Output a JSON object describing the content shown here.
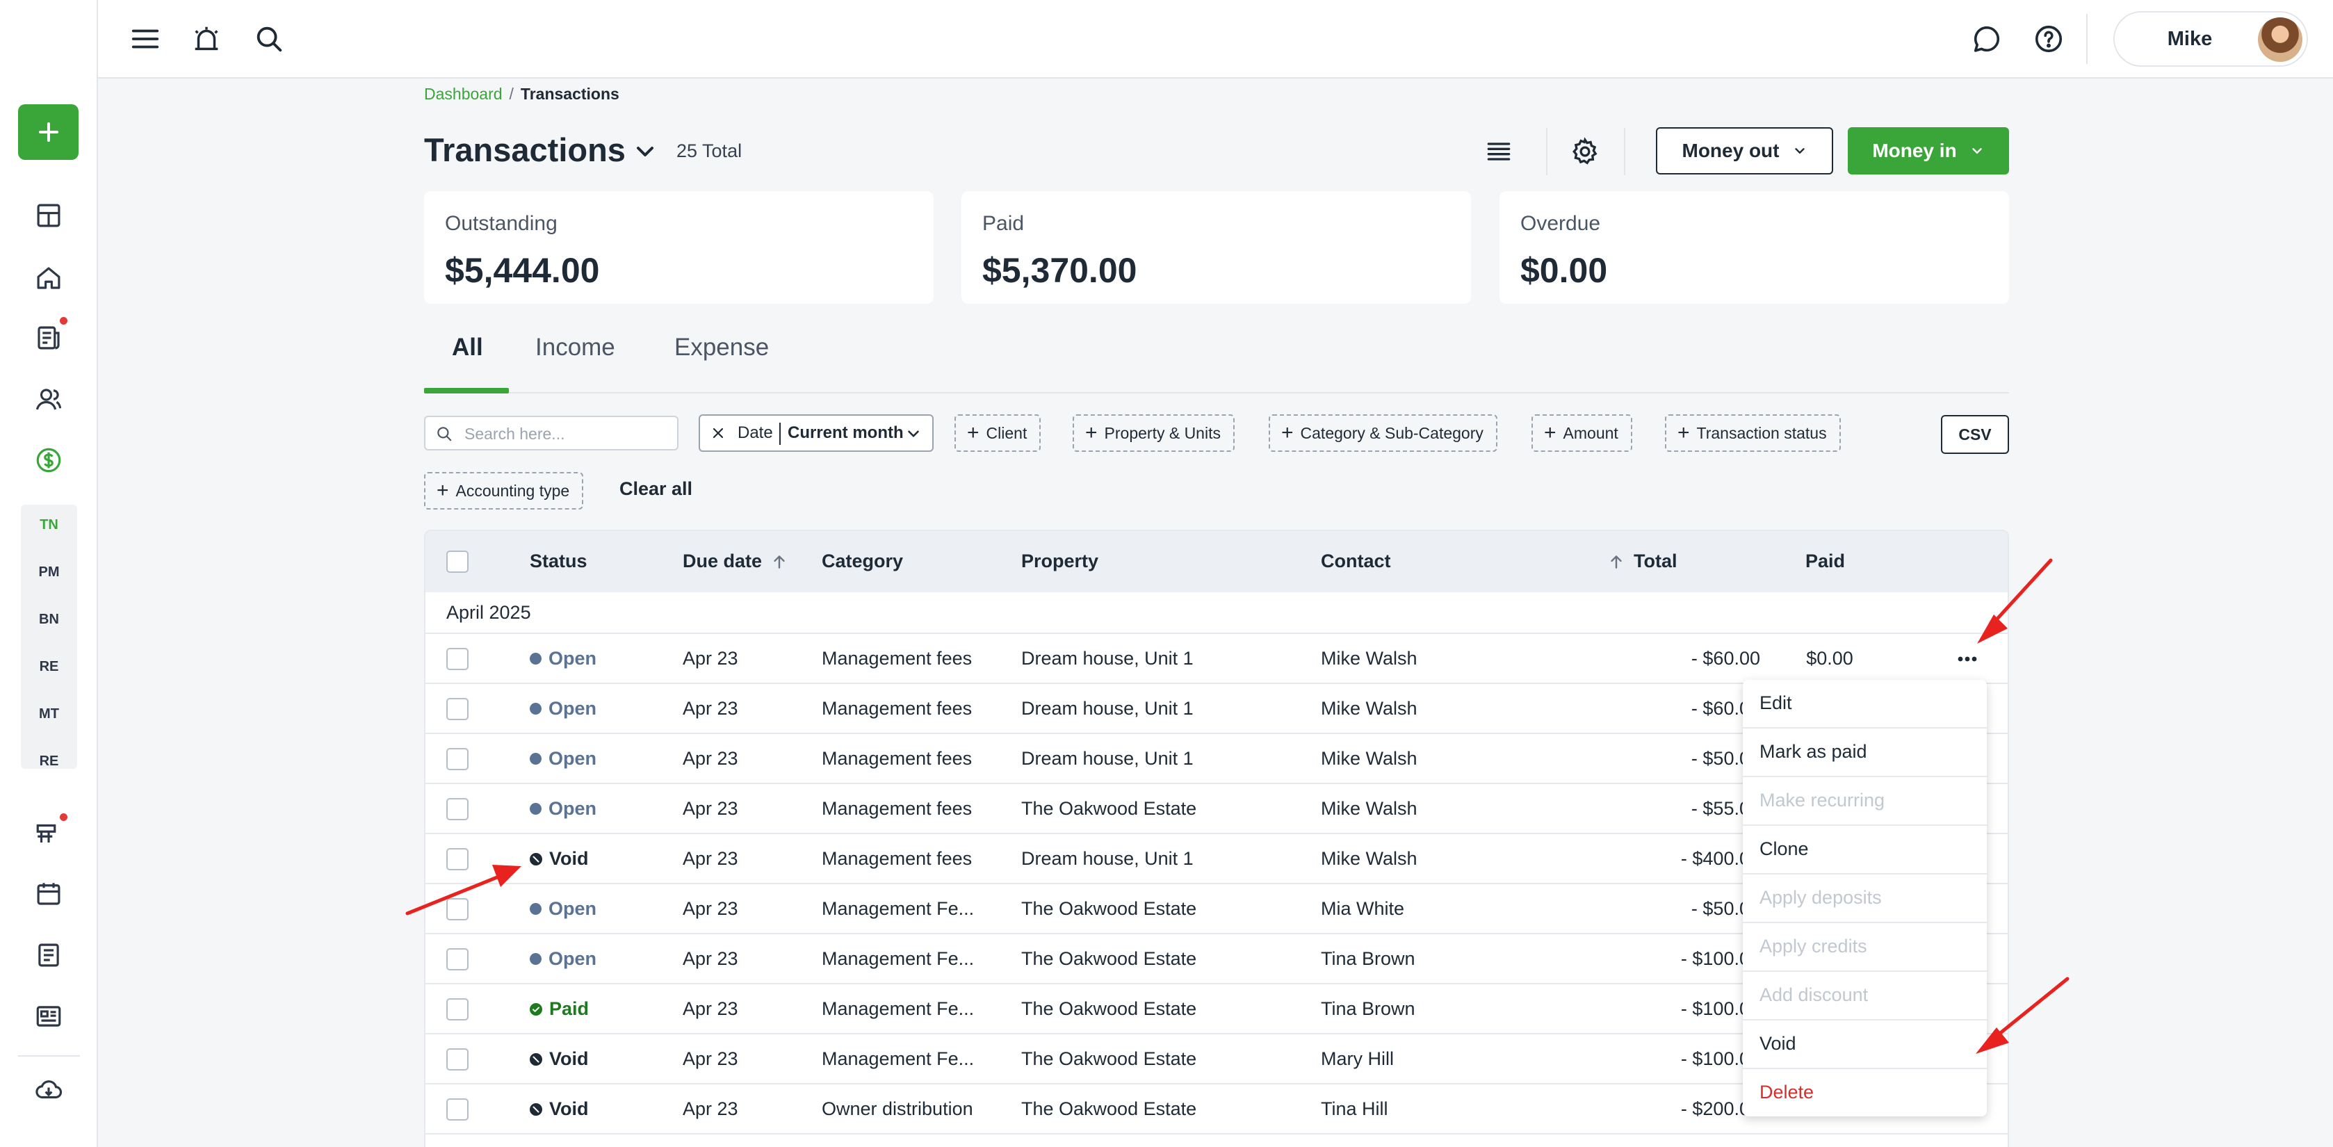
{
  "sidebar": {
    "add_label": "+",
    "sub_items": [
      "TN",
      "PM",
      "BN",
      "RE",
      "MT",
      "RE"
    ],
    "icons": [
      "dashboard-icon",
      "home-icon",
      "document-icon",
      "users-icon",
      "money-icon",
      "campaign-icon",
      "calendar-icon",
      "notes-icon",
      "news-icon",
      "cloud-download-icon"
    ]
  },
  "topbar": {
    "user_name": "Mike"
  },
  "breadcrumb": {
    "link": "Dashboard",
    "separator": "/",
    "current": "Transactions"
  },
  "header": {
    "title": "Transactions",
    "total": "25 Total",
    "money_out": "Money out",
    "money_in": "Money in"
  },
  "cards": [
    {
      "label": "Outstanding",
      "value": "$5,444.00"
    },
    {
      "label": "Paid",
      "value": "$5,370.00"
    },
    {
      "label": "Overdue",
      "value": "$0.00"
    }
  ],
  "tabs": [
    "All",
    "Income",
    "Expense"
  ],
  "filters": {
    "search_placeholder": "Search here...",
    "date_label": "Date",
    "date_value": "Current month",
    "chips": [
      "Client",
      "Property & Units",
      "Category & Sub-Category",
      "Amount",
      "Transaction status",
      "Accounting type"
    ],
    "clear_all": "Clear all",
    "csv": "CSV"
  },
  "table": {
    "columns": {
      "status": "Status",
      "due_date": "Due date",
      "category": "Category",
      "property": "Property",
      "contact": "Contact",
      "total": "Total",
      "paid": "Paid"
    },
    "group": "April 2025",
    "rows": [
      {
        "status": "Open",
        "due": "Apr 23",
        "category": "Management fees",
        "property": "Dream house, Unit 1",
        "contact": "Mike Walsh",
        "total": "- $60.00",
        "paid": "$0.00"
      },
      {
        "status": "Open",
        "due": "Apr 23",
        "category": "Management fees",
        "property": "Dream house, Unit 1",
        "contact": "Mike Walsh",
        "total": "- $60.00",
        "paid": ""
      },
      {
        "status": "Open",
        "due": "Apr 23",
        "category": "Management fees",
        "property": "Dream house, Unit 1",
        "contact": "Mike Walsh",
        "total": "- $50.00",
        "paid": ""
      },
      {
        "status": "Open",
        "due": "Apr 23",
        "category": "Management fees",
        "property": "The Oakwood Estate",
        "contact": "Mike Walsh",
        "total": "- $55.00",
        "paid": ""
      },
      {
        "status": "Void",
        "due": "Apr 23",
        "category": "Management fees",
        "property": "Dream house, Unit 1",
        "contact": "Mike Walsh",
        "total": "- $400.00",
        "paid": ""
      },
      {
        "status": "Open",
        "due": "Apr 23",
        "category": "Management Fe...",
        "property": "The Oakwood Estate",
        "contact": "Mia White",
        "total": "- $50.00",
        "paid": ""
      },
      {
        "status": "Open",
        "due": "Apr 23",
        "category": "Management Fe...",
        "property": "The Oakwood Estate",
        "contact": "Tina Brown",
        "total": "- $100.00",
        "paid": ""
      },
      {
        "status": "Paid",
        "due": "Apr 23",
        "category": "Management Fe...",
        "property": "The Oakwood Estate",
        "contact": "Tina Brown",
        "total": "- $100.00",
        "paid": ""
      },
      {
        "status": "Void",
        "due": "Apr 23",
        "category": "Management Fe...",
        "property": "The Oakwood Estate",
        "contact": "Mary Hill",
        "total": "- $100.00",
        "paid": ""
      },
      {
        "status": "Void",
        "due": "Apr 23",
        "category": "Owner distribution",
        "property": "The Oakwood Estate",
        "contact": "Tina Hill",
        "total": "- $200.00",
        "paid": ""
      }
    ]
  },
  "context_menu": [
    {
      "label": "Edit",
      "state": "enabled"
    },
    {
      "label": "Mark as paid",
      "state": "enabled"
    },
    {
      "label": "Make recurring",
      "state": "disabled"
    },
    {
      "label": "Clone",
      "state": "enabled"
    },
    {
      "label": "Apply deposits",
      "state": "disabled"
    },
    {
      "label": "Apply credits",
      "state": "disabled"
    },
    {
      "label": "Add discount",
      "state": "disabled"
    },
    {
      "label": "Void",
      "state": "enabled"
    },
    {
      "label": "Delete",
      "state": "danger"
    }
  ],
  "colors": {
    "brand_green": "#3aa63a",
    "open_status": "#5a7394",
    "paid_status": "#1f7a1f",
    "danger": "#d32f2f",
    "annotation_arrow": "#e8231f"
  }
}
